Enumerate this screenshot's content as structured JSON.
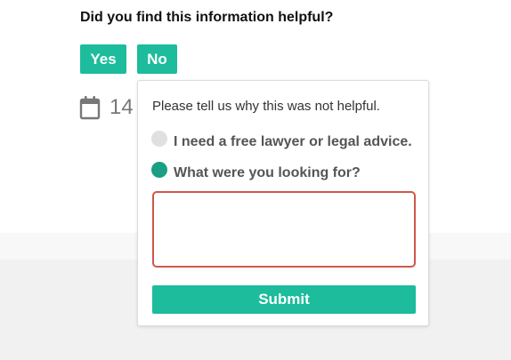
{
  "feedback": {
    "question": "Did you find this information helpful?",
    "yes_label": "Yes",
    "no_label": "No"
  },
  "date": {
    "icon": "calendar-icon",
    "text": "14"
  },
  "popup": {
    "prompt": "Please tell us why this was not helpful.",
    "options": [
      {
        "label": "I need a free lawyer or legal advice.",
        "selected": false
      },
      {
        "label": "What were you looking for?",
        "selected": true
      }
    ],
    "answer_value": "",
    "submit_label": "Submit"
  },
  "colors": {
    "accent": "#1cbc9c",
    "radio_selected": "#1a9e84",
    "radio_unselected": "#e0e0e0",
    "error_border": "#d0574a"
  }
}
